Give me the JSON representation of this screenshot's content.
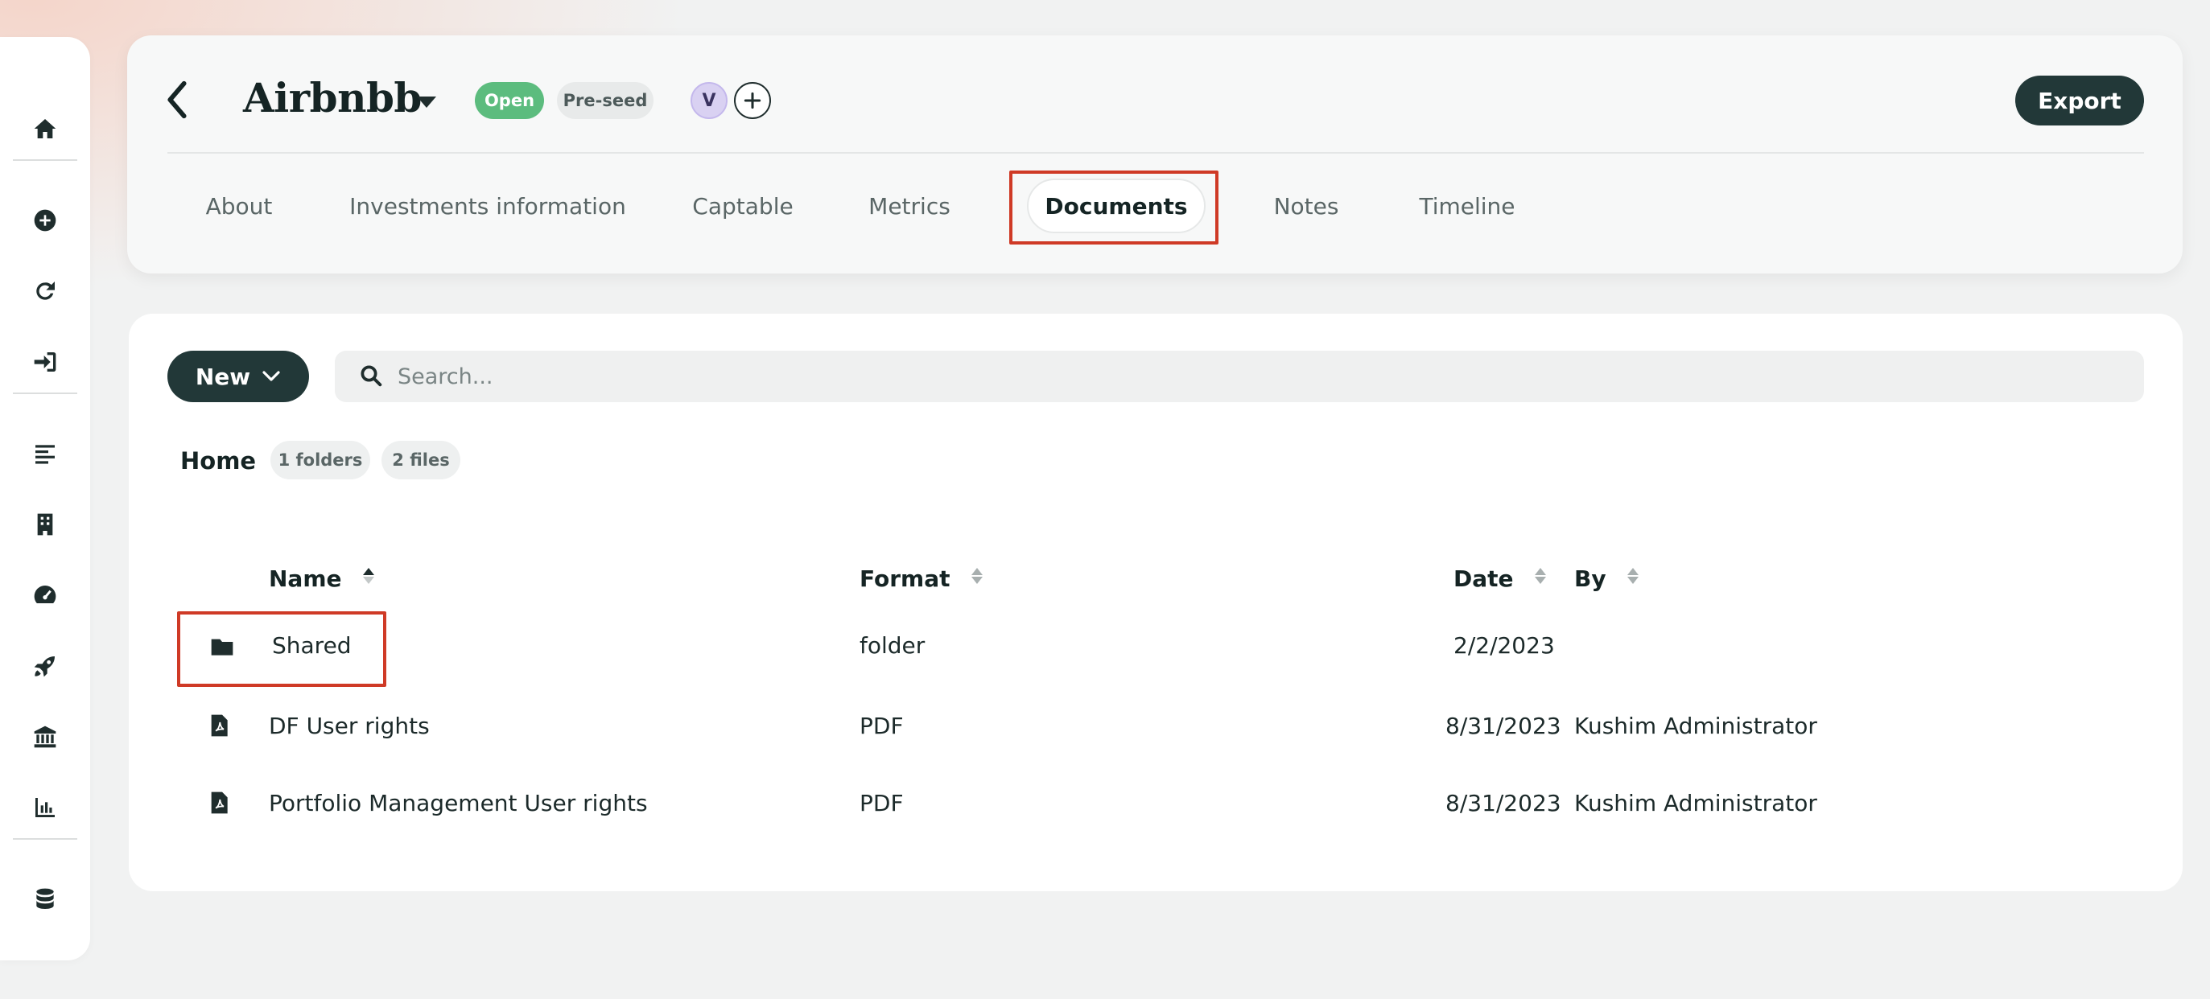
{
  "header": {
    "company_name": "Airbnbb",
    "status_badge": "Open",
    "stage_badge": "Pre-seed",
    "avatar_initial": "V",
    "export_label": "Export",
    "tabs": [
      {
        "label": "About"
      },
      {
        "label": "Investments information"
      },
      {
        "label": "Captable"
      },
      {
        "label": "Metrics"
      },
      {
        "label": "Documents"
      },
      {
        "label": "Notes"
      },
      {
        "label": "Timeline"
      }
    ],
    "active_tab": "Documents"
  },
  "sidebar": {
    "icons": [
      "home-icon",
      "plus-circle-icon",
      "refresh-icon",
      "sign-in-icon",
      "align-left-icon",
      "building-icon",
      "gauge-icon",
      "rocket-icon",
      "bank-icon",
      "bar-chart-icon",
      "database-icon"
    ]
  },
  "documents": {
    "new_label": "New",
    "search_placeholder": "Search...",
    "breadcrumb": "Home",
    "folders_count": "1 folders",
    "files_count": "2 files",
    "columns": {
      "name": "Name",
      "format": "Format",
      "date": "Date",
      "by": "By"
    },
    "rows": [
      {
        "icon": "folder-icon",
        "name": "Shared",
        "format": "folder",
        "date": "2/2/2023",
        "by": ""
      },
      {
        "icon": "file-pdf-icon",
        "name": "DF User rights",
        "format": "PDF",
        "date": "8/31/2023",
        "by": "Kushim Administrator"
      },
      {
        "icon": "file-pdf-icon",
        "name": "Portfolio Management User rights",
        "format": "PDF",
        "date": "8/31/2023",
        "by": "Kushim Administrator"
      }
    ]
  },
  "colors": {
    "accent_dark": "#223838",
    "open_green": "#5cbc7e",
    "highlight_red": "#cf3a26"
  }
}
